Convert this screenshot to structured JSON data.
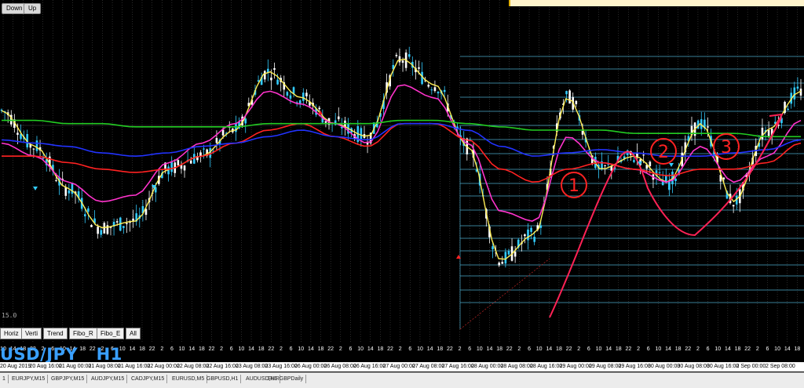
{
  "window": {
    "buttons": [
      "Down",
      "Up"
    ]
  },
  "chart_data": {
    "type": "line",
    "title": "USD/JPY   H1",
    "timeframe_label": "15.0",
    "session_ticks": [
      "10",
      "14",
      "18",
      "22",
      "2",
      "6",
      "10",
      "14",
      "18",
      "22",
      "2",
      "6",
      "10",
      "14",
      "18",
      "22",
      "2",
      "6",
      "10",
      "14",
      "18",
      "22",
      "2",
      "6",
      "10",
      "14",
      "18",
      "22",
      "2",
      "6",
      "10",
      "14",
      "18",
      "22",
      "2",
      "6",
      "10",
      "14",
      "18",
      "22",
      "2",
      "6",
      "10",
      "14",
      "18",
      "22",
      "2",
      "6",
      "10",
      "14",
      "18",
      "22",
      "2",
      "6",
      "10",
      "14",
      "18",
      "22",
      "2",
      "6",
      "10",
      "14",
      "18",
      "22",
      "2",
      "6",
      "10",
      "14",
      "18",
      "22",
      "2",
      "6",
      "10",
      "14",
      "18",
      "22",
      "2",
      "6",
      "10",
      "14",
      "18"
    ],
    "date_labels": [
      "20 Aug 2019",
      "20 Aug 16:00",
      "21 Aug 00:00",
      "21 Aug 08:00",
      "21 Aug 16:00",
      "22 Aug 00:00",
      "22 Aug 08:00",
      "22 Aug 16:00",
      "23 Aug 08:00",
      "23 Aug 16:00",
      "26 Aug 00:00",
      "26 Aug 08:00",
      "26 Aug 16:00",
      "27 Aug 00:00",
      "27 Aug 08:00",
      "27 Aug 16:00",
      "28 Aug 00:00",
      "28 Aug 08:00",
      "28 Aug 16:00",
      "29 Aug 00:00",
      "29 Aug 08:00",
      "29 Aug 16:00",
      "30 Aug 00:00",
      "30 Aug 08:00",
      "30 Aug 16:00",
      "2 Sep 00:00",
      "2 Sep 08:00"
    ],
    "series": [
      {
        "color": "#ffee55",
        "values": [
          0.66,
          0.55,
          0.42,
          0.3,
          0.32,
          0.48,
          0.52,
          0.6,
          0.78,
          0.7,
          0.62,
          0.58,
          0.82,
          0.74,
          0.55,
          0.2,
          0.28,
          0.7,
          0.48,
          0.52,
          0.44,
          0.62,
          0.38,
          0.6,
          0.72
        ]
      },
      {
        "color": "#ff33cc",
        "values": [
          0.56,
          0.52,
          0.44,
          0.38,
          0.4,
          0.5,
          0.56,
          0.62,
          0.72,
          0.68,
          0.62,
          0.56,
          0.74,
          0.7,
          0.56,
          0.35,
          0.32,
          0.58,
          0.5,
          0.48,
          0.44,
          0.55,
          0.44,
          0.52,
          0.63
        ]
      },
      {
        "color": "#ff2222",
        "values": [
          0.52,
          0.52,
          0.5,
          0.48,
          0.47,
          0.48,
          0.52,
          0.56,
          0.6,
          0.62,
          0.58,
          0.55,
          0.62,
          0.62,
          0.57,
          0.48,
          0.44,
          0.48,
          0.5,
          0.48,
          0.46,
          0.48,
          0.48,
          0.5,
          0.56
        ]
      },
      {
        "color": "#2233ff",
        "values": [
          0.57,
          0.56,
          0.55,
          0.53,
          0.52,
          0.53,
          0.55,
          0.56,
          0.58,
          0.6,
          0.58,
          0.57,
          0.62,
          0.62,
          0.6,
          0.55,
          0.52,
          0.53,
          0.54,
          0.53,
          0.52,
          0.52,
          0.53,
          0.54,
          0.57
        ]
      },
      {
        "color": "#22cc22",
        "values": [
          0.63,
          0.63,
          0.62,
          0.62,
          0.61,
          0.61,
          0.61,
          0.61,
          0.62,
          0.62,
          0.62,
          0.62,
          0.63,
          0.63,
          0.62,
          0.61,
          0.6,
          0.6,
          0.6,
          0.59,
          0.59,
          0.59,
          0.59,
          0.58,
          0.58
        ]
      }
    ],
    "annotations": [
      "1",
      "2",
      "3"
    ]
  },
  "toolbar": {
    "buttons": [
      "Horiz",
      "Verti",
      "Trend",
      "Fibo_R",
      "Fibo_E",
      "All"
    ]
  },
  "tabs": [
    "1",
    "EURJPY,M15",
    "GBPJPY,M15",
    "AUDJPY,M15",
    "CADJPY,M15",
    "EURUSD,M5",
    "GBPUSD,H1",
    "AUDUSD,H1",
    "EURGBPDaily"
  ]
}
